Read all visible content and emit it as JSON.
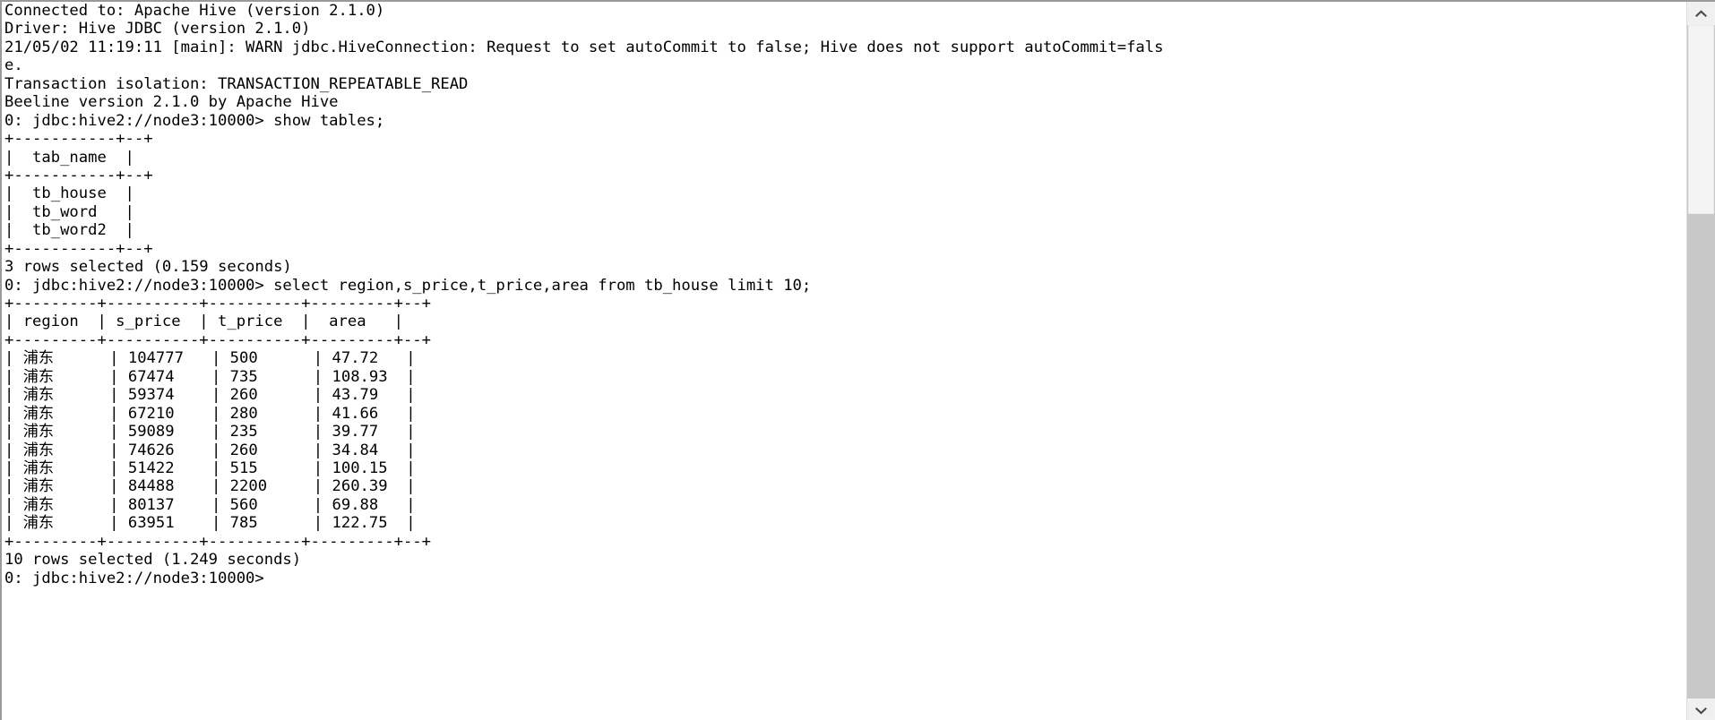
{
  "window": {
    "kind": "terminal",
    "title": "Beeline Hive CLI",
    "background_color": "#ffffff",
    "text_color": "#000000",
    "border_color": "#9a9a9a"
  },
  "scrollbar": {
    "orientation": "vertical",
    "up_arrow_icon": "chevron-up-icon",
    "down_arrow_icon": "chevron-down-icon",
    "track_color": "#c8c8c8",
    "thumb_color": "#f4f4f4",
    "thumb_position_percent": 0,
    "thumb_size_percent": 28
  },
  "console": {
    "prompt": "0: jdbc:hive2://node3:10000>",
    "lines": [
      "Connected to: Apache Hive (version 2.1.0)",
      "Driver: Hive JDBC (version 2.1.0)",
      "21/05/02 11:19:11 [main]: WARN jdbc.HiveConnection: Request to set autoCommit to false; Hive does not support autoCommit=fals",
      "e.",
      "Transaction isolation: TRANSACTION_REPEATABLE_READ",
      "Beeline version 2.1.0 by Apache Hive",
      "0: jdbc:hive2://node3:10000> show tables;",
      "+-----------+--+",
      "|  tab_name  |",
      "+-----------+--+",
      "|  tb_house  |",
      "|  tb_word   |",
      "|  tb_word2  |",
      "+-----------+--+",
      "3 rows selected (0.159 seconds)",
      "0: jdbc:hive2://node3:10000> select region,s_price,t_price,area from tb_house limit 10;",
      "+---------+----------+----------+---------+--+",
      "| region  | s_price  | t_price  |  area   |",
      "+---------+----------+----------+---------+--+",
      "| 浦东      | 104777   | 500      | 47.72   |",
      "| 浦东      | 67474    | 735      | 108.93  |",
      "| 浦东      | 59374    | 260      | 43.79   |",
      "| 浦东      | 67210    | 280      | 41.66   |",
      "| 浦东      | 59089    | 235      | 39.77   |",
      "| 浦东      | 74626    | 260      | 34.84   |",
      "| 浦东      | 51422    | 515      | 100.15  |",
      "| 浦东      | 84488    | 2200     | 260.39  |",
      "| 浦东      | 80137    | 560      | 69.88   |",
      "| 浦东      | 63951    | 785      | 122.75  |",
      "+---------+----------+----------+---------+--+",
      "10 rows selected (1.249 seconds)",
      "0: jdbc:hive2://node3:10000>"
    ],
    "session_info": {
      "connected_to": "Apache Hive (version 2.1.0)",
      "driver": "Hive JDBC (version 2.1.0)",
      "warning_timestamp": "21/05/02 11:19:11",
      "warning_thread": "[main]",
      "warning_level": "WARN",
      "warning_logger": "jdbc.HiveConnection",
      "warning_message": "Request to set autoCommit to false; Hive does not support autoCommit=false.",
      "transaction_isolation": "TRANSACTION_REPEATABLE_READ",
      "beeline_version": "Beeline version 2.1.0 by Apache Hive"
    },
    "queries": [
      {
        "sql": "show tables;",
        "columns": [
          "tab_name"
        ],
        "rows": [
          [
            "tb_house"
          ],
          [
            "tb_word"
          ],
          [
            "tb_word2"
          ]
        ],
        "result_status": "3 rows selected (0.159 seconds)"
      },
      {
        "sql": "select region,s_price,t_price,area from tb_house limit 10;",
        "columns": [
          "region",
          "s_price",
          "t_price",
          "area"
        ],
        "rows": [
          [
            "浦东",
            "104777",
            "500",
            "47.72"
          ],
          [
            "浦东",
            "67474",
            "735",
            "108.93"
          ],
          [
            "浦东",
            "59374",
            "260",
            "43.79"
          ],
          [
            "浦东",
            "67210",
            "280",
            "41.66"
          ],
          [
            "浦东",
            "59089",
            "235",
            "39.77"
          ],
          [
            "浦东",
            "74626",
            "260",
            "34.84"
          ],
          [
            "浦东",
            "51422",
            "515",
            "100.15"
          ],
          [
            "浦东",
            "84488",
            "2200",
            "260.39"
          ],
          [
            "浦东",
            "80137",
            "560",
            "69.88"
          ],
          [
            "浦东",
            "63951",
            "785",
            "122.75"
          ]
        ],
        "result_status": "10 rows selected (1.249 seconds)"
      }
    ]
  }
}
